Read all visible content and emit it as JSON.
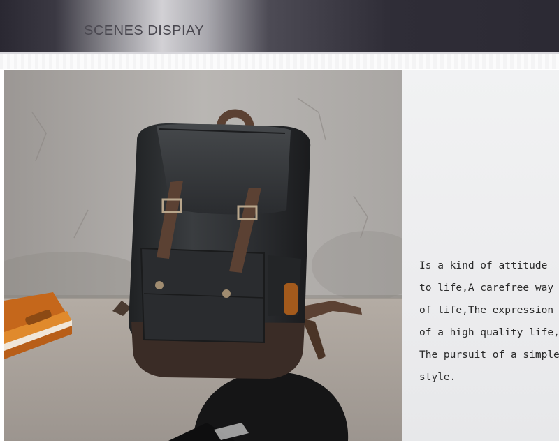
{
  "header": {
    "title": "SCENES DISPIAY"
  },
  "product": {
    "description_lines": [
      "Is a kind of attitude",
      "to life,A carefree way",
      "of life,The expression",
      "of a high quality life,",
      "The pursuit of a simple",
      "style."
    ]
  },
  "colors": {
    "header_dark": "#2c2a34",
    "header_light": "#d2d1d5",
    "panel_bg": "#eeeff0",
    "text": "#2b2b2b",
    "bag_leather": "#2d2f31",
    "bag_base": "#3a2c26",
    "strap_brown": "#5b4133",
    "notebook_orange": "#c26a1e"
  }
}
